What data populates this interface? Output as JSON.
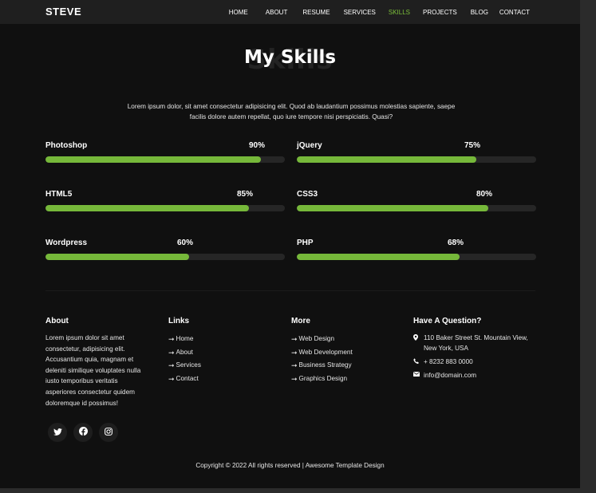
{
  "nav": {
    "brand": "STEVE",
    "items": [
      {
        "label": "HOME",
        "active": false
      },
      {
        "label": "ABOUT",
        "active": false
      },
      {
        "label": "RESUME",
        "active": false
      },
      {
        "label": "SERVICES",
        "active": false
      },
      {
        "label": "SKILLS",
        "active": true
      },
      {
        "label": "PROJECTS",
        "active": false
      },
      {
        "label": "BLOG",
        "active": false
      },
      {
        "label": "CONTACT",
        "active": false
      }
    ]
  },
  "skills_section": {
    "background_word": "Skills",
    "title": "My Skills",
    "intro": "Lorem ipsum dolor, sit amet consectetur adipisicing elit. Quod ab laudantium possimus molestias sapiente, saepe facilis dolore autem repellat, quo iure tempore nisi perspiciatis. Quasi?",
    "skills": [
      {
        "name": "Photoshop",
        "percent_label": "90%",
        "value": 90
      },
      {
        "name": "jQuery",
        "percent_label": "75%",
        "value": 75
      },
      {
        "name": "HTML5",
        "percent_label": "85%",
        "value": 85
      },
      {
        "name": "CSS3",
        "percent_label": "80%",
        "value": 80
      },
      {
        "name": "Wordpress",
        "percent_label": "60%",
        "value": 60
      },
      {
        "name": "PHP",
        "percent_label": "68%",
        "value": 68
      }
    ]
  },
  "footer": {
    "about": {
      "heading": "About",
      "text": "Lorem ipsum dolor sit amet consectetur, adipisicing elit. Accusantium quia, magnam et deleniti similique voluptates nulla iusto temporibus veritatis asperiores consectetur quidem doloremque id possimus!"
    },
    "links": {
      "heading": "Links",
      "items": [
        "Home",
        "About",
        "Services",
        "Contact"
      ]
    },
    "more": {
      "heading": "More",
      "items": [
        "Web Design",
        "Web Development",
        "Business Strategy",
        "Graphics Design"
      ]
    },
    "question": {
      "heading": "Have A Question?",
      "address": "110 Baker Street St. Mountain View, New York, USA",
      "phone": "+ 8232 883 0000",
      "email": "info@domain.com"
    },
    "socials": [
      {
        "icon": "twitter-icon"
      },
      {
        "icon": "facebook-icon"
      },
      {
        "icon": "instagram-icon"
      }
    ],
    "copyright": "Copyright © 2022 All rights reserved | Awesome Template Design"
  },
  "colors": {
    "accent": "#76b83a",
    "active_nav": "#7bbf3a",
    "background": "#101010"
  }
}
